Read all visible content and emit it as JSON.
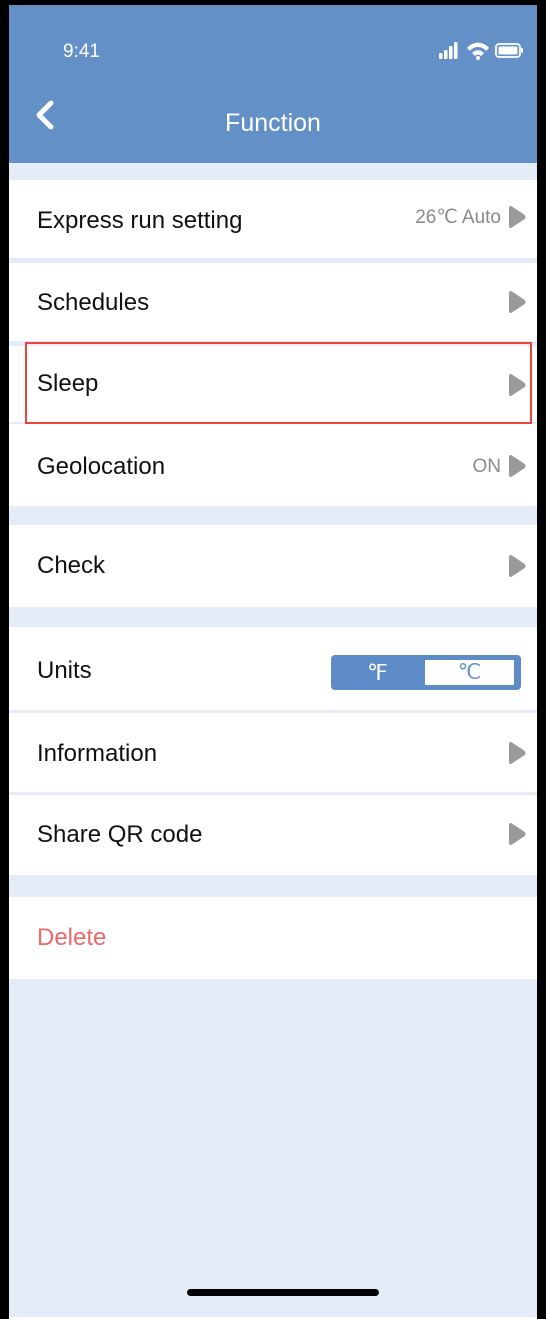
{
  "status_bar": {
    "time": "9:41"
  },
  "header": {
    "title": "Function"
  },
  "rows": [
    {
      "label": "Express run setting",
      "value": "26℃ Auto"
    },
    {
      "label": "Schedules"
    },
    {
      "label": "Sleep"
    },
    {
      "label": "Geolocation",
      "value": "ON"
    },
    {
      "label": "Check"
    },
    {
      "label": "Units"
    },
    {
      "label": "Information"
    },
    {
      "label": "Share QR code"
    },
    {
      "label": "Delete"
    }
  ],
  "units_toggle": {
    "option_f": "℉",
    "option_c": "℃",
    "selected": "℃"
  },
  "colors": {
    "header": "#6490c8",
    "background": "#e3ecf7",
    "delete": "#ea6a6a",
    "highlight": "#e8463a",
    "chevron": "#9a9a9a"
  },
  "icons": {
    "back": "chevron-left-icon",
    "chevron": "chevron-right-icon",
    "signal": "signal-icon",
    "wifi": "wifi-icon",
    "battery": "battery-icon"
  }
}
